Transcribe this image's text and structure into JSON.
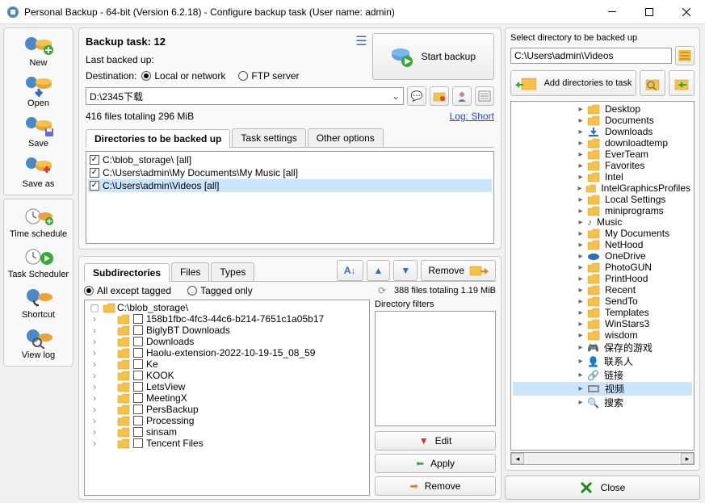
{
  "window": {
    "title": "Personal Backup - 64-bit (Version 6.2.18) - Configure backup task (User name: admin)"
  },
  "sidebar": {
    "group1": [
      {
        "label": "New"
      },
      {
        "label": "Open"
      },
      {
        "label": "Save"
      },
      {
        "label": "Save as"
      }
    ],
    "group2": [
      {
        "label": "Time schedule"
      },
      {
        "label": "Task Scheduler"
      },
      {
        "label": "Shortcut"
      },
      {
        "label": "View log"
      }
    ]
  },
  "task": {
    "title": "Backup task: 12",
    "last": "Last backed up:",
    "start": "Start backup",
    "dest_label": "Destination:",
    "dest_local": "Local or network",
    "dest_ftp": "FTP server",
    "dest_path": "D:\\2345下载",
    "stats": "416 files totaling 296 MiB",
    "log_link": "Log: Short",
    "tabs": [
      "Directories to be backed up",
      "Task settings",
      "Other options"
    ],
    "dirs": [
      "C:\\blob_storage\\ [all]",
      "C:\\Users\\admin\\My Documents\\My Music [all]",
      "C:\\Users\\admin\\Videos [all]"
    ]
  },
  "sub": {
    "tabs": [
      "Subdirectories",
      "Files",
      "Types"
    ],
    "remove": "Remove",
    "all_except": "All except tagged",
    "tagged_only": "Tagged only",
    "stats": "388 files totaling 1.19 MiB",
    "root": "C:\\blob_storage\\",
    "nodes": [
      "158b1fbc-4fc3-44c6-b214-7651c1a05b17",
      "BiglyBT Downloads",
      "Downloads",
      "Haolu-extension-2022-10-19-15_08_59",
      "Ke",
      "KOOK",
      "LetsView",
      "MeetingX",
      "PersBackup",
      "Processing",
      "sinsam",
      "Tencent Files"
    ],
    "filter_title": "Directory filters",
    "edit": "Edit",
    "apply": "Apply",
    "remove2": "Remove"
  },
  "right": {
    "title": "Select directory to be backed up",
    "path": "C:\\Users\\admin\\Videos",
    "add": "Add directories to task",
    "nodes": [
      {
        "t": "Desktop",
        "i": "f"
      },
      {
        "t": "Documents",
        "i": "f"
      },
      {
        "t": "Downloads",
        "i": "dl"
      },
      {
        "t": "downloadtemp",
        "i": "f"
      },
      {
        "t": "EverTeam",
        "i": "f"
      },
      {
        "t": "Favorites",
        "i": "f"
      },
      {
        "t": "Intel",
        "i": "f"
      },
      {
        "t": "IntelGraphicsProfiles",
        "i": "f"
      },
      {
        "t": "Local Settings",
        "i": "f"
      },
      {
        "t": "miniprograms",
        "i": "f"
      },
      {
        "t": "Music",
        "i": "m"
      },
      {
        "t": "My Documents",
        "i": "f"
      },
      {
        "t": "NetHood",
        "i": "f"
      },
      {
        "t": "OneDrive",
        "i": "od"
      },
      {
        "t": "PhotoGUN",
        "i": "f"
      },
      {
        "t": "PrintHood",
        "i": "f"
      },
      {
        "t": "Recent",
        "i": "f"
      },
      {
        "t": "SendTo",
        "i": "f"
      },
      {
        "t": "Templates",
        "i": "f"
      },
      {
        "t": "WinStars3",
        "i": "f"
      },
      {
        "t": "wisdom",
        "i": "f"
      },
      {
        "t": "保存的游戏",
        "i": "g"
      },
      {
        "t": "联系人",
        "i": "c"
      },
      {
        "t": "链接",
        "i": "l"
      },
      {
        "t": "视频",
        "i": "v",
        "sel": true
      },
      {
        "t": "搜索",
        "i": "s"
      }
    ],
    "close": "Close"
  }
}
